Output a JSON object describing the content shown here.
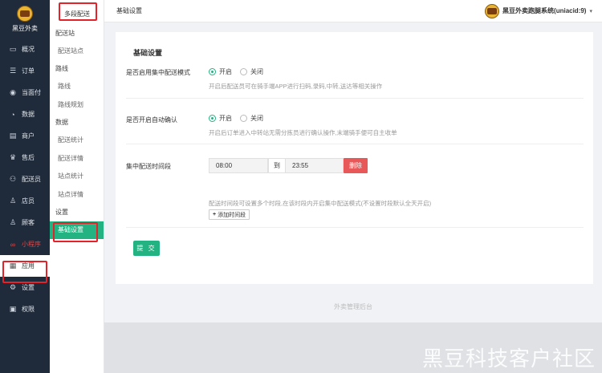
{
  "app": {
    "brand_name": "黑豆外卖"
  },
  "nav": {
    "items": [
      {
        "label": "概况",
        "icon": "monitor-icon"
      },
      {
        "label": "订单",
        "icon": "order-list-icon"
      },
      {
        "label": "当面付",
        "icon": "pay-icon"
      },
      {
        "label": "数据",
        "icon": "chart-icon"
      },
      {
        "label": "商户",
        "icon": "store-icon"
      },
      {
        "label": "售后",
        "icon": "service-icon"
      },
      {
        "label": "配送员",
        "icon": "courier-icon"
      },
      {
        "label": "店员",
        "icon": "clerk-icon"
      },
      {
        "label": "顾客",
        "icon": "customer-icon"
      },
      {
        "label": "小程序",
        "icon": "mini-program-icon"
      },
      {
        "label": "应用",
        "icon": "apps-grid-icon"
      },
      {
        "label": "设置",
        "icon": "gear-icon"
      },
      {
        "label": "权限",
        "icon": "lock-icon"
      }
    ]
  },
  "submenu": {
    "title": "多段配送",
    "groups": [
      {
        "label": "配送站",
        "links": [
          "配送站点"
        ]
      },
      {
        "label": "路线",
        "links": [
          "路线",
          "路线规划"
        ]
      },
      {
        "label": "数据",
        "links": [
          "配送统计",
          "配送详情",
          "站点统计",
          "站点详情"
        ]
      },
      {
        "label": "设置",
        "links": [
          "基础设置"
        ]
      }
    ]
  },
  "header": {
    "title": "基础设置",
    "user": "黑豆外卖跑腿系统(uniacid:9)"
  },
  "form": {
    "section_title": "基础设置",
    "centralized": {
      "label": "是否启用集中配送模式",
      "option_on": "开启",
      "option_off": "关闭",
      "selected": "开启",
      "help": "开启后配送员可在骑手端APP进行扫码,录码,中转,送达等相关操作"
    },
    "auto_confirm": {
      "label": "是否开启自动确认",
      "option_on": "开启",
      "option_off": "关闭",
      "selected": "开启",
      "help": "开启后订单进入中转站无需分拣员进行确认操作,末端骑手便可自主收单"
    },
    "time_range": {
      "label": "集中配送时间段",
      "start": "08:00",
      "to": "到",
      "end": "23:55",
      "delete_label": "删除",
      "help": "配送时间段可设置多个时段,在该时段内开启集中配送模式(不设置时段默认全天开启)",
      "add_label": "添加时间段"
    },
    "submit_label": "提 交"
  },
  "footer": {
    "text": "外卖管理后台"
  },
  "watermark": {
    "text": "黑豆科技客户社区"
  },
  "colors": {
    "accent": "#23b383",
    "danger": "#e85858",
    "sidebar": "#1f2a3a",
    "highlight": "#e3222a"
  }
}
